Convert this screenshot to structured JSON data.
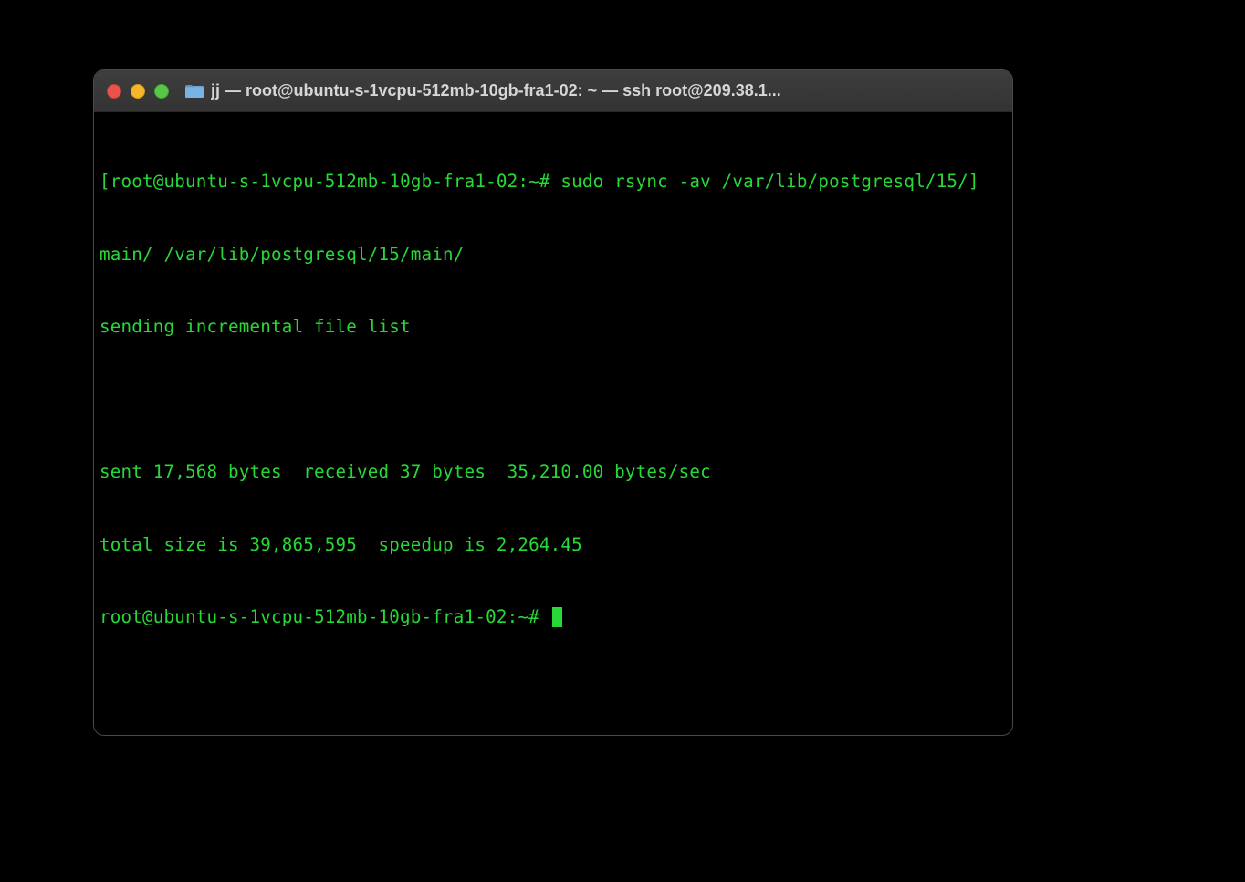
{
  "titlebar": {
    "title": "jj — root@ubuntu-s-1vcpu-512mb-10gb-fra1-02: ~ — ssh root@209.38.1...",
    "folder_icon": "folder-icon"
  },
  "terminal": {
    "line1_open_bracket": "[",
    "line1_prompt": "root@ubuntu-s-1vcpu-512mb-10gb-fra1-02:~# ",
    "line1_cmd_part1": "sudo rsync -av /var/lib/postgresql/15/",
    "line1_close_bracket": "]",
    "line2": "main/ /var/lib/postgresql/15/main/",
    "line3": "sending incremental file list",
    "line4_blank": "",
    "line5": "sent 17,568 bytes  received 37 bytes  35,210.00 bytes/sec",
    "line6": "total size is 39,865,595  speedup is 2,264.45",
    "line7_prompt": "root@ubuntu-s-1vcpu-512mb-10gb-fra1-02:~# "
  }
}
